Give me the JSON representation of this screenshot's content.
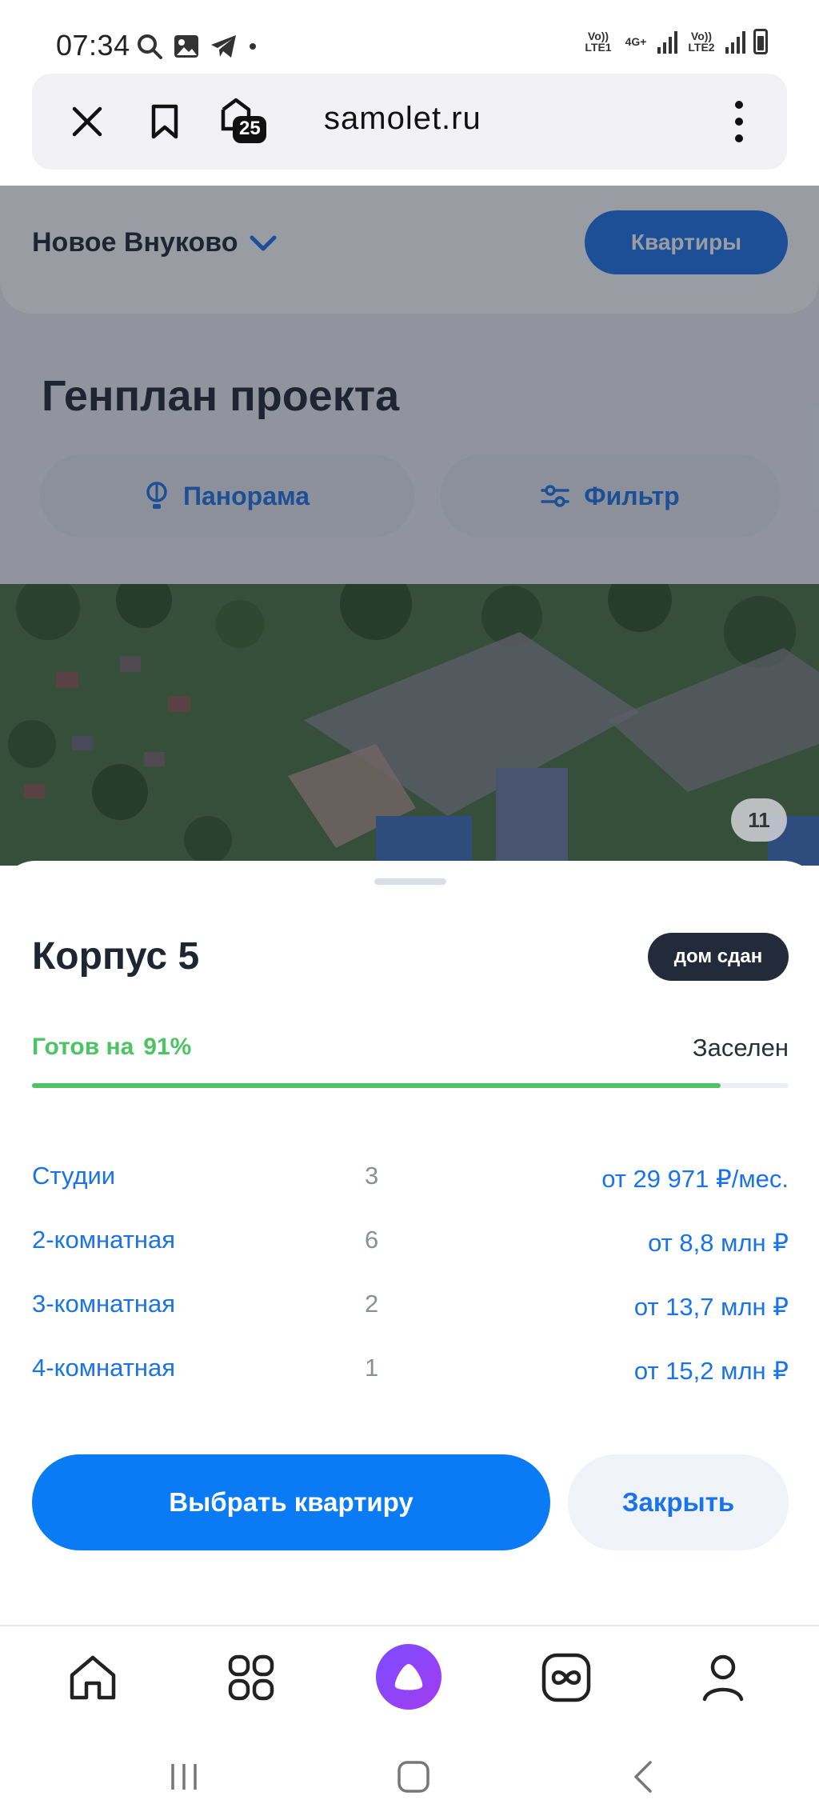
{
  "status_bar": {
    "time": "07:34",
    "sim1": "Vo)) LTE1",
    "net_type": "4G+",
    "sim2": "Vo)) LTE2"
  },
  "browser": {
    "url": "samolet.ru",
    "tabs_count": "25",
    "icons": [
      "close-icon",
      "bookmark-icon",
      "tabs-icon",
      "more-vert-icon"
    ]
  },
  "page": {
    "project_name": "Новое Внуково",
    "apartments_button": "Квартиры",
    "heading": "Генплан проекта",
    "panorama_label": "Панорама",
    "filter_label": "Фильтр",
    "map_badge": "11"
  },
  "sheet": {
    "title": "Корпус 5",
    "badge": "дом сдан",
    "ready_label": "Готов на",
    "ready_value": "91%",
    "ready_fraction": 0.91,
    "status": "Заселен",
    "rows": [
      {
        "name": "Студии",
        "count": "3",
        "price": "от 29 971 ₽/мес."
      },
      {
        "name": "2-комнатная",
        "count": "6",
        "price": "от 8,8 млн ₽"
      },
      {
        "name": "3-комнатная",
        "count": "2",
        "price": "от 13,7 млн ₽"
      },
      {
        "name": "4-комнатная",
        "count": "1",
        "price": "от 15,2 млн ₽"
      }
    ],
    "primary_button": "Выбрать квартиру",
    "secondary_button": "Закрыть"
  },
  "colors": {
    "accent": "#0a7af5",
    "link": "#1a73e8",
    "success": "#4cc463",
    "dark_badge": "#232a3a"
  }
}
